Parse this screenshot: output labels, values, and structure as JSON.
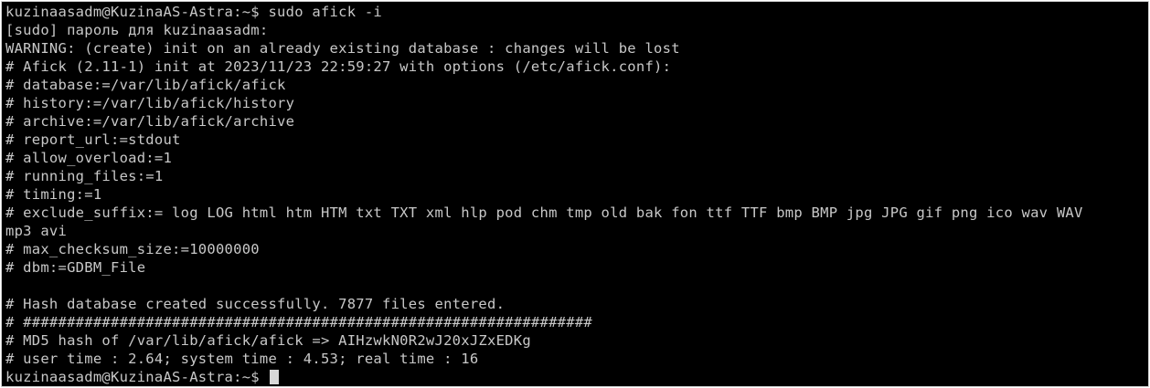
{
  "terminal": {
    "background": "#000000",
    "foreground": "#c8c8c8",
    "lines": [
      "kuzinaasadm@KuzinaAS-Astra:~$ sudo afick -i",
      "[sudo] пароль для kuzinaasadm:",
      "WARNING: (create) init on an already existing database : changes will be lost",
      "# Afick (2.11-1) init at 2023/11/23 22:59:27 with options (/etc/afick.conf):",
      "# database:=/var/lib/afick/afick",
      "# history:=/var/lib/afick/history",
      "# archive:=/var/lib/afick/archive",
      "# report_url:=stdout",
      "# allow_overload:=1",
      "# running_files:=1",
      "# timing:=1",
      "# exclude_suffix:= log LOG html htm HTM txt TXT xml hlp pod chm tmp old bak fon ttf TTF bmp BMP jpg JPG gif png ico wav WAV",
      "mp3 avi",
      "# max_checksum_size:=10000000",
      "# dbm:=GDBM_File",
      "",
      "# Hash database created successfully. 7877 files entered.",
      "# #################################################################",
      "# MD5 hash of /var/lib/afick/afick => AIHzwkN0R2wJ20xJZxEDKg",
      "# user time : 2.64; system time : 4.53; real time : 16"
    ],
    "prompt": "kuzinaasadm@KuzinaAS-Astra:~$ "
  }
}
